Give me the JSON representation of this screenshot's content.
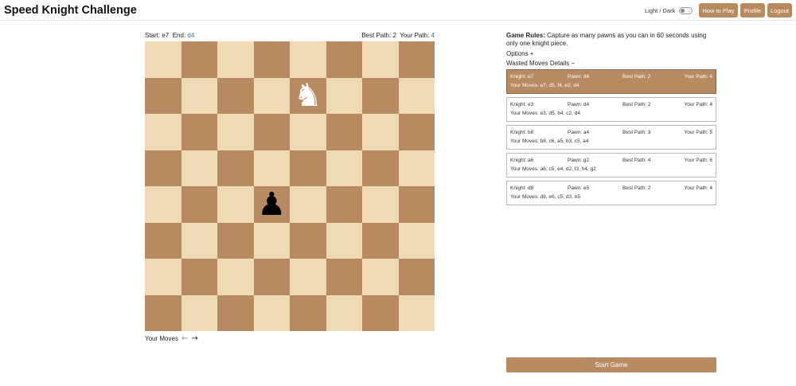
{
  "app": {
    "title": "Speed Knight Challenge"
  },
  "header": {
    "theme_toggle_label": "Light / Dark",
    "how_to_play": "How to Play",
    "profile": "Profile",
    "logout": "Logout"
  },
  "board_info": {
    "start_label": "Start:",
    "start_value": "e7",
    "end_label": "End:",
    "end_value": "d4",
    "best_path_label": "Best Path:",
    "best_path_value": "2",
    "your_path_label": "Your Path:",
    "your_path_value": "4"
  },
  "board": {
    "colors": {
      "light": "#f0d9b5",
      "dark": "#b88a62"
    },
    "pieces": [
      {
        "square": "e7",
        "piece": "knight",
        "color": "white",
        "glyph": "♞"
      },
      {
        "square": "d4",
        "piece": "pawn",
        "color": "black",
        "glyph": "♟"
      }
    ]
  },
  "moves_nav": {
    "label": "Your Moves",
    "prev_icon": "arrow-left-icon",
    "next_icon": "arrow-right-icon"
  },
  "rules": {
    "title": "Game Rules:",
    "text": "Capture as many pawns as you can in 60 seconds using only one knight piece."
  },
  "options_label": "Options +",
  "wasted_label": "Wasted Moves Details −",
  "wasted_moves": [
    {
      "knight": "Knight: e7",
      "pawn": "Pawn: d4",
      "best": "Best Path: 2",
      "your": "Your Path: 4",
      "moves": "Your Moves: e7, d5, f4, e2, d4"
    },
    {
      "knight": "Knight: e3",
      "pawn": "Pawn: d4",
      "best": "Best Path: 2",
      "your": "Your Path: 4",
      "moves": "Your Moves: e3, d5, b4, c2, d4"
    },
    {
      "knight": "Knight: b8",
      "pawn": "Pawn: a4",
      "best": "Best Path: 3",
      "your": "Your Path: 5",
      "moves": "Your Moves: b8, c6, a5, b3, c5, a4"
    },
    {
      "knight": "Knight: a6",
      "pawn": "Pawn: g2",
      "best": "Best Path: 4",
      "your": "Your Path: 6",
      "moves": "Your Moves: a6, c5, e4, d2, f3, h4, g2"
    },
    {
      "knight": "Knight: d8",
      "pawn": "Pawn: e5",
      "best": "Best Path: 2",
      "your": "Your Path: 4",
      "moves": "Your Moves: d8, e6, c5, d3, e5"
    }
  ],
  "start_button": "Start Game"
}
